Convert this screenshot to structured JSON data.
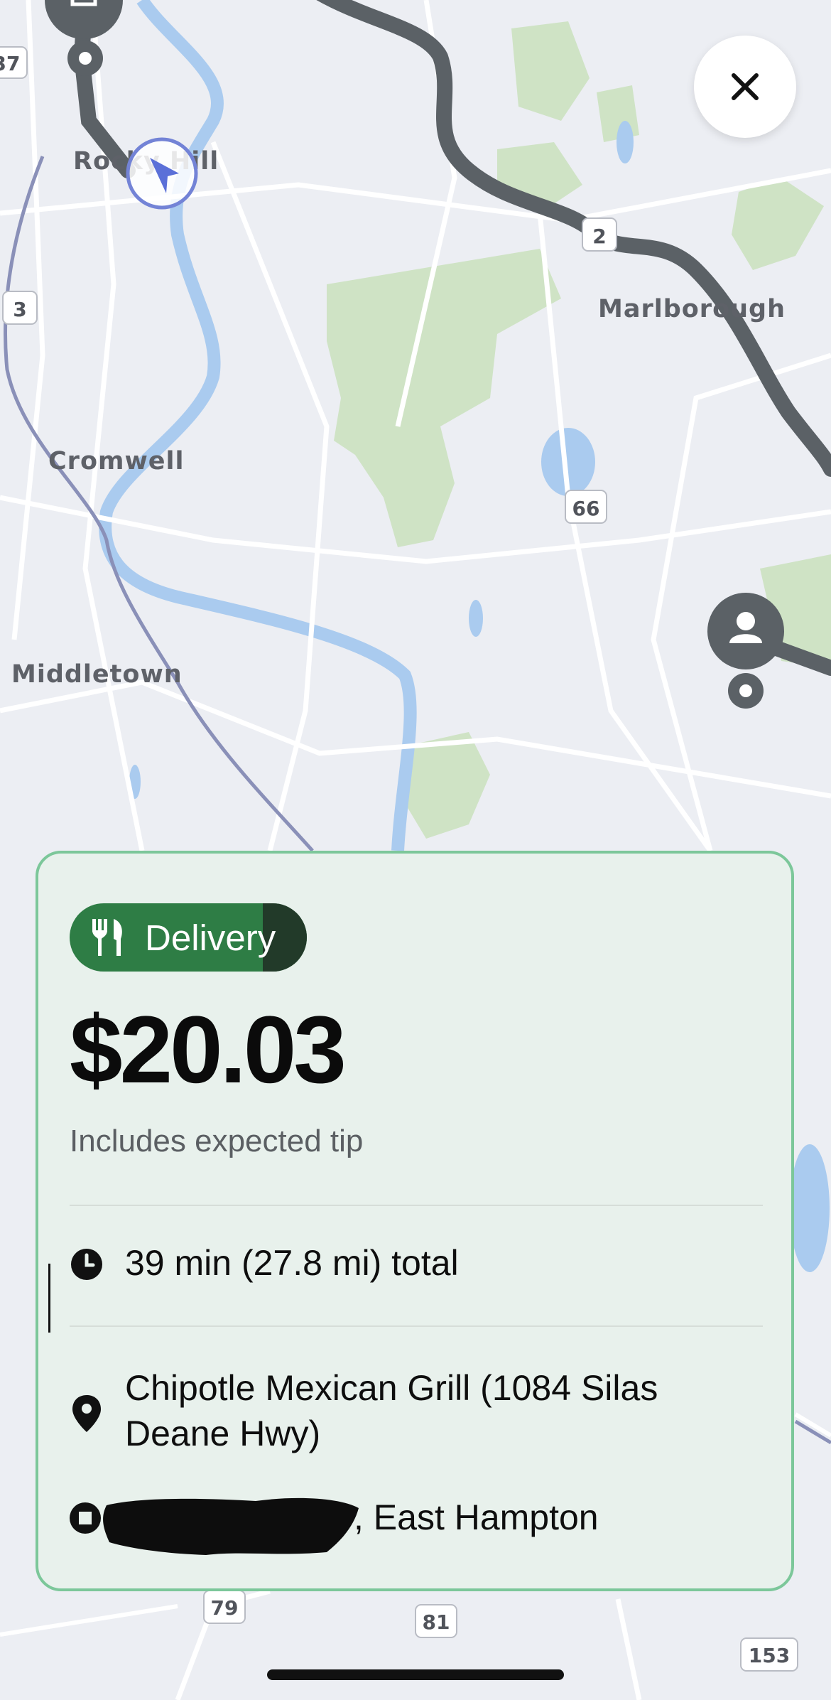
{
  "map": {
    "places": [
      {
        "name": "Rocky Hill"
      },
      {
        "name": "Cromwell"
      },
      {
        "name": "Middletown"
      },
      {
        "name": "Marlborough"
      }
    ],
    "route_shields": [
      "2",
      "3",
      "66",
      "79",
      "81",
      "153",
      "37"
    ],
    "icons": [
      "navigation-arrow-icon",
      "person-icon",
      "store-icon"
    ]
  },
  "close_button": {
    "icon": "close-icon"
  },
  "offer": {
    "badge_label": "Delivery",
    "badge_icon": "fork-knife-icon",
    "price": "$20.03",
    "price_note": "Includes expected tip",
    "duration": "39 min (27.8 mi) total",
    "pickup_line1": "Chipotle Mexican Grill (1084 Silas",
    "pickup_line2": "Deane Hwy)",
    "dropoff_visible": ", East Hampton"
  },
  "colors": {
    "card_bg": "#e8f1ec",
    "card_border": "#7cc79a",
    "badge_bg": "#2e7d45",
    "route": "#5b6166",
    "water": "#aacbef",
    "park": "#cfe3c5"
  }
}
